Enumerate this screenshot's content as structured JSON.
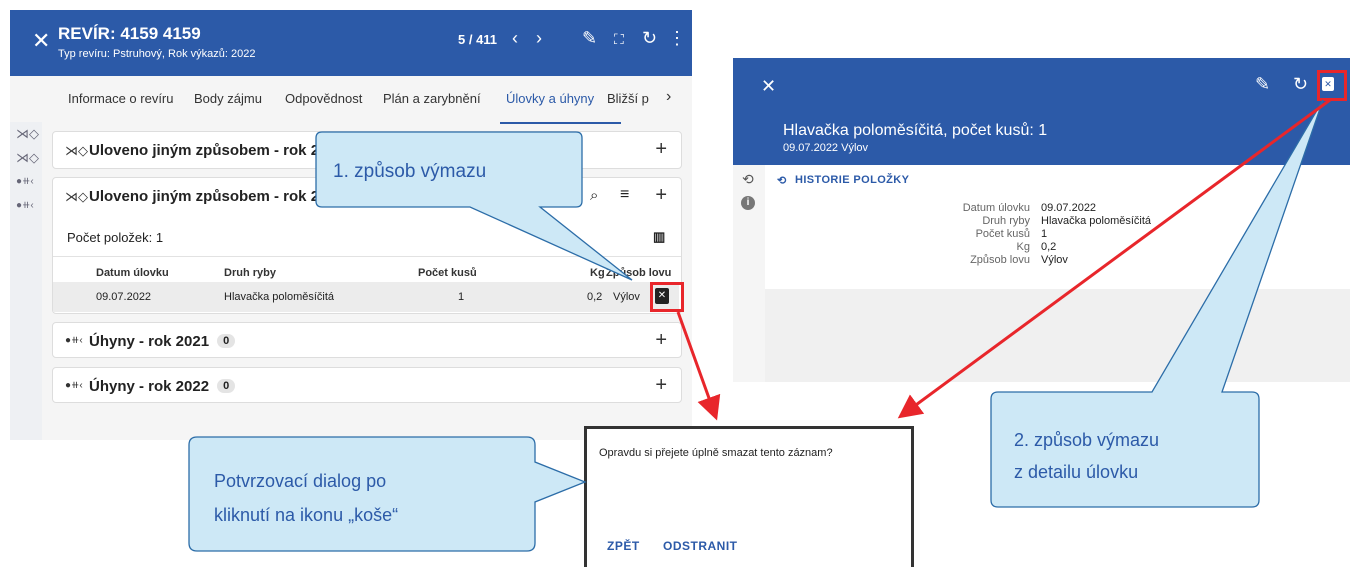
{
  "left": {
    "title": "REVÍR: 4159 4159",
    "subtitle": "Typ revíru: Pstruhový, Rok výkazů: 2022",
    "counter": "5 / 411",
    "tabs": [
      "Informace o revíru",
      "Body zájmu",
      "Odpovědnost",
      "Plán a zarybnění",
      "Úlovky a úhyny",
      "Bližší p"
    ],
    "active_tab": "Úlovky a úhyny",
    "card1": {
      "title": "Uloveno jiným způsobem - rok 20"
    },
    "card2": {
      "title": "Uloveno jiným způsobem - rok 202",
      "count_label": "Počet položek: 1",
      "headers": [
        "Datum úlovku",
        "Druh ryby",
        "Počet kusů",
        "Kg",
        "Způsob lovu"
      ],
      "row": {
        "date": "09.07.2022",
        "species": "Hlavačka poloměsíčitá",
        "count": "1",
        "kg": "0,2",
        "method": "Výlov"
      }
    },
    "card3": {
      "title": "Úhyny - rok 2021",
      "badge": "0"
    },
    "card4": {
      "title": "Úhyny - rok 2022",
      "badge": "0"
    }
  },
  "right": {
    "title": "Hlavačka poloměsíčitá, počet kusů: 1",
    "subtitle": "09.07.2022 Výlov",
    "history_label": "HISTORIE POLOŽKY",
    "fields": [
      {
        "label": "Datum úlovku",
        "value": "09.07.2022"
      },
      {
        "label": "Druh ryby",
        "value": "Hlavačka poloměsíčitá"
      },
      {
        "label": "Počet kusů",
        "value": "1"
      },
      {
        "label": "Kg",
        "value": "0,2"
      },
      {
        "label": "Způsob lovu",
        "value": "Výlov"
      }
    ]
  },
  "dialog": {
    "question": "Opravdu si přejete úplně smazat tento záznam?",
    "back": "ZPĚT",
    "delete": "ODSTRANIT"
  },
  "callouts": {
    "first": "1. způsob výmazu",
    "second_line1": "2. způsob výmazu",
    "second_line2": "z detailu úlovku",
    "dialog_line1": "Potvrzovací dialog po",
    "dialog_line2": "kliknutí na ikonu „koše“"
  },
  "colors": {
    "primary": "#2c5aa8",
    "callout_fill": "#cde8f6",
    "callout_stroke": "#2c6da8",
    "highlight": "#e8262b"
  },
  "icons": [
    "close-icon",
    "chevron-left-icon",
    "chevron-right-icon",
    "edit-icon",
    "fullscreen-icon",
    "refresh-icon",
    "more-icon",
    "fish-icon",
    "fish-skeleton-icon",
    "search-icon",
    "list-icon",
    "columns-icon",
    "plus-icon",
    "trash-icon",
    "history-icon",
    "info-icon"
  ]
}
